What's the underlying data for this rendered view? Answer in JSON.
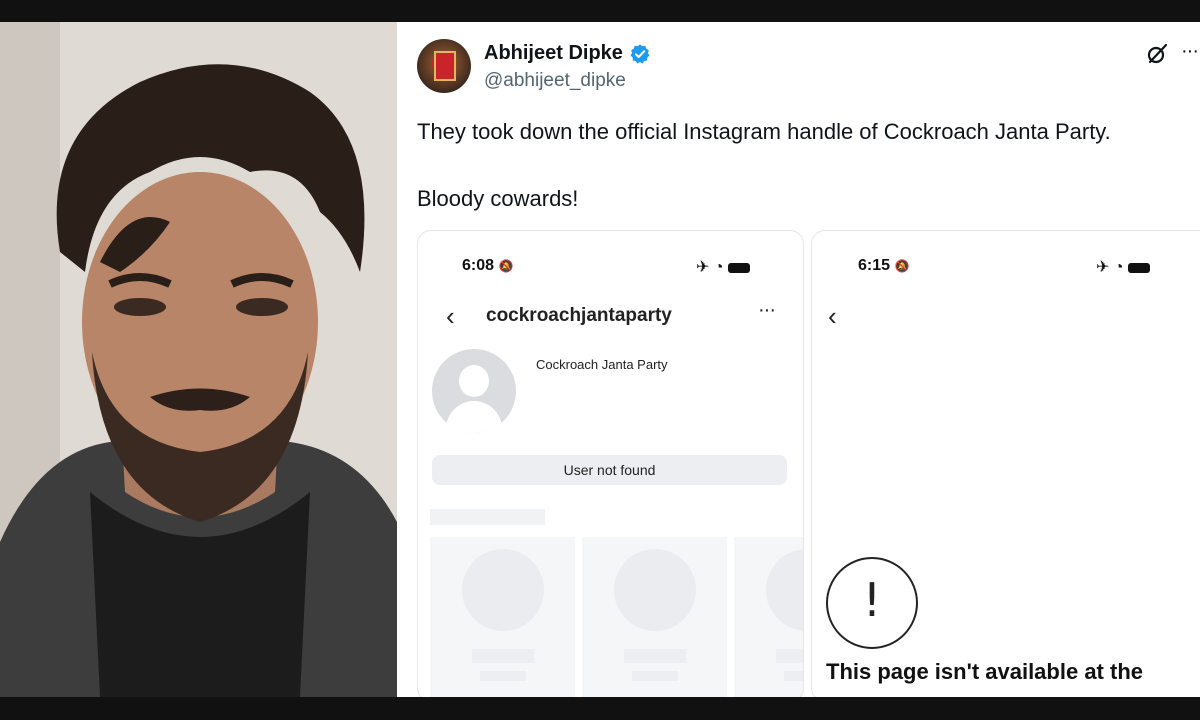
{
  "tweet": {
    "author_name": "Abhijeet Dipke",
    "author_handle": "@abhijeet_dipke",
    "text_line1": "They took down the official Instagram handle of Cockroach Janta Party.",
    "text_line2": "Bloody cowards!",
    "verified_color": "#1d9bf0"
  },
  "screenshot1": {
    "time": "6:08",
    "username": "cockroachjantaparty",
    "full_name": "Cockroach Janta Party",
    "status_button": "User not found"
  },
  "screenshot2": {
    "time": "6:15",
    "message": "This page isn't available at the"
  },
  "icons": {
    "verified": "verified-badge-icon",
    "grok": "grok-icon",
    "more": "more-options-icon",
    "back": "back-chevron-icon",
    "warning": "exclamation-icon"
  }
}
